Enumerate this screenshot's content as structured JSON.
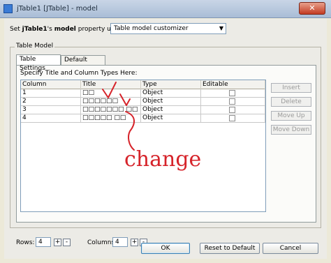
{
  "window": {
    "title": "jTable1 [JTable] - model",
    "close_label": "✕"
  },
  "property_row": {
    "prefix": "Set ",
    "bean": "jTable1",
    "middle": "'s ",
    "property": "model",
    "suffix": " property using:",
    "selected": "Table model customizer"
  },
  "group": {
    "title": "Table Model"
  },
  "tabs": [
    {
      "label": "Table Settings",
      "active": true
    },
    {
      "label": "Default Values",
      "active": false
    }
  ],
  "panel": {
    "instruction": "Specify Title and Column Types Here:"
  },
  "table": {
    "headers": [
      "Column",
      "Title",
      "Type",
      "Editable"
    ],
    "rows": [
      {
        "column": "1",
        "title": "□□",
        "type": "Object",
        "editable": false
      },
      {
        "column": "2",
        "title": "□□□□□□",
        "type": "Object",
        "editable": false
      },
      {
        "column": "3",
        "title": "□□□□□□□ □□",
        "type": "Object",
        "editable": false
      },
      {
        "column": "4",
        "title": "□□□□□ □□",
        "type": "Object",
        "editable": false
      }
    ]
  },
  "side_buttons": [
    "Insert",
    "Delete",
    "Move Up",
    "Move Down"
  ],
  "counts": {
    "rows_label": "Rows:",
    "rows_value": "4",
    "columns_label": "Columns:",
    "columns_value": "4",
    "plus": "+",
    "minus": "-"
  },
  "buttons": {
    "ok": "OK",
    "reset": "Reset to Default",
    "cancel": "Cancel"
  },
  "annotation": {
    "text": "change",
    "color": "#d6232a"
  },
  "colors": {
    "accent": "#3c7fb1",
    "titlebar": "#b9c9de"
  }
}
